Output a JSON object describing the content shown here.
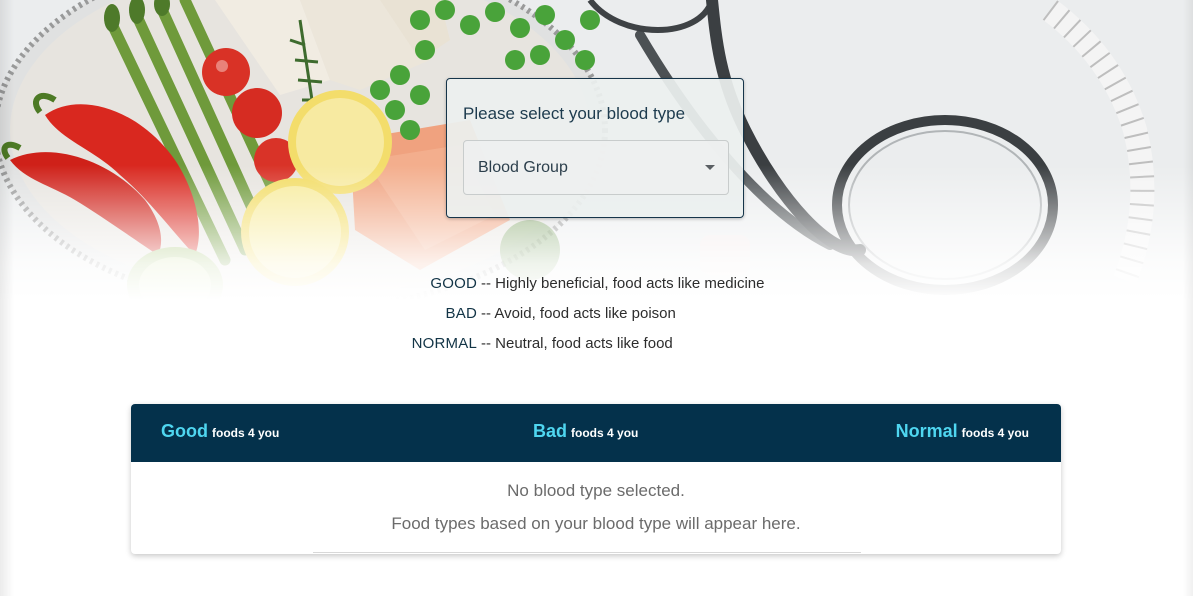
{
  "select": {
    "prompt": "Please select your blood type",
    "value": "Blood Group"
  },
  "legend": [
    {
      "key": "GOOD",
      "desc": "-- Highly beneficial, food acts like medicine"
    },
    {
      "key": "BAD",
      "desc": "-- Avoid, food acts like poison"
    },
    {
      "key": "NORMAL",
      "desc": "-- Neutral, food acts like food"
    }
  ],
  "table": {
    "columns": [
      {
        "title": "Good",
        "suffix": "foods 4 you"
      },
      {
        "title": "Bad",
        "suffix": "foods 4 you"
      },
      {
        "title": "Normal",
        "suffix": "foods 4 you"
      }
    ],
    "empty_title": "No blood type selected.",
    "empty_message": "Food types based on your blood type will appear here."
  },
  "colors": {
    "header_bg": "#04314b",
    "header_accent": "#4fd6f0",
    "legend_key": "#123446"
  },
  "icons": {
    "select_caret": "caret-down-icon"
  }
}
